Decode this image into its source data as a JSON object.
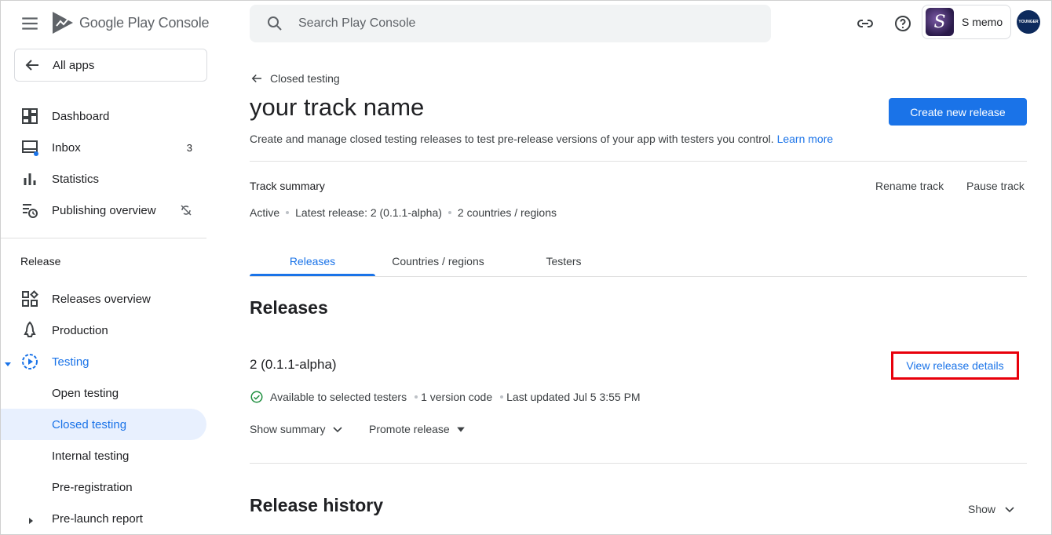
{
  "brand": {
    "name": "Google Play Console"
  },
  "search": {
    "placeholder": "Search Play Console"
  },
  "app": {
    "name": "S memo",
    "thumb_letter": "S"
  },
  "avatar": {
    "text": "YOUNGER"
  },
  "sidebar": {
    "all_apps": "All apps",
    "items": [
      {
        "label": "Dashboard",
        "icon": "dashboard-icon"
      },
      {
        "label": "Inbox",
        "icon": "inbox-icon",
        "count": "3"
      },
      {
        "label": "Statistics",
        "icon": "bar-chart-icon"
      },
      {
        "label": "Publishing overview",
        "icon": "publishing-overview-icon"
      }
    ],
    "section": "Release",
    "release_items": [
      {
        "label": "Releases overview",
        "icon": "releases-overview-icon"
      },
      {
        "label": "Production",
        "icon": "production-icon"
      },
      {
        "label": "Testing",
        "icon": "testing-icon"
      },
      {
        "label": "Open testing"
      },
      {
        "label": "Closed testing"
      },
      {
        "label": "Internal testing"
      },
      {
        "label": "Pre-registration"
      },
      {
        "label": "Pre-launch report"
      }
    ]
  },
  "main": {
    "back_label": "Closed testing",
    "title": "your track name",
    "description": "Create and manage closed testing releases to test pre-release versions of your app with testers you control.",
    "learn_more": "Learn more",
    "create_button": "Create new release",
    "track_summary": "Track summary",
    "rename_track": "Rename track",
    "pause_track": "Pause track",
    "summary": {
      "status": "Active",
      "latest_release": "Latest release: 2 (0.1.1-alpha)",
      "countries": "2 countries / regions"
    },
    "tabs": [
      "Releases",
      "Countries / regions",
      "Testers"
    ],
    "releases_heading": "Releases",
    "release": {
      "name": "2 (0.1.1-alpha)",
      "view_details": "View release details",
      "availability": "Available to selected testers",
      "version_codes": "1 version code",
      "last_updated": "Last updated Jul 5 3:55 PM",
      "show_summary": "Show summary",
      "promote": "Promote release"
    },
    "history_heading": "Release history",
    "history_show": "Show"
  },
  "colors": {
    "accent": "#1a73e8",
    "highlight": "#e8000b",
    "success": "#1e8e3e"
  }
}
